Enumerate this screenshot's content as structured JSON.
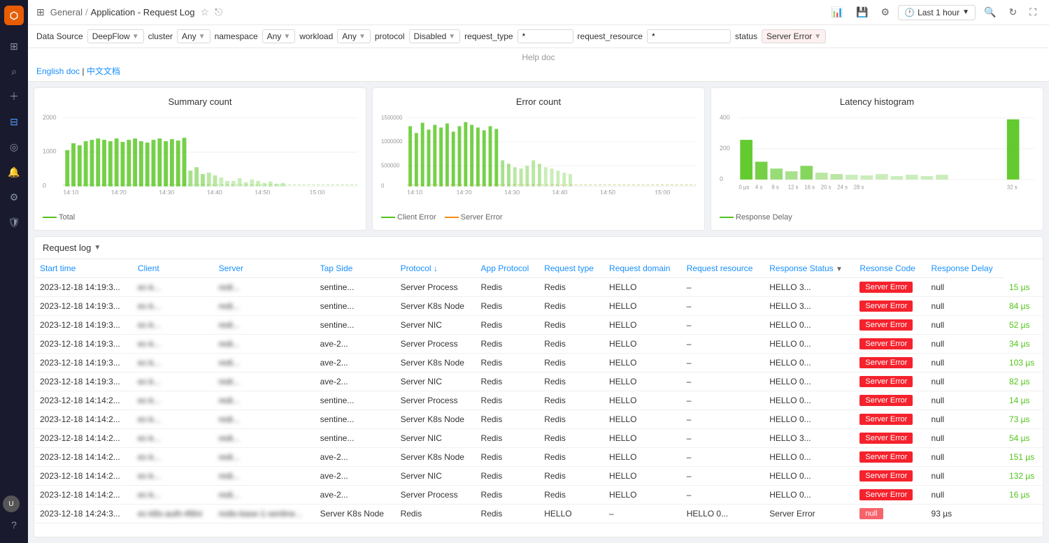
{
  "sidebar": {
    "logo": "D",
    "icons": [
      "⊞",
      "🔍",
      "+",
      "⊟",
      "◎",
      "🔔",
      "⚙",
      "🛡"
    ]
  },
  "topbar": {
    "breadcrumb": "General / Application - Request Log",
    "time_label": "Last 1 hour",
    "icons": [
      "chart",
      "save",
      "settings",
      "time",
      "zoom-in",
      "refresh",
      "fullscreen"
    ]
  },
  "filters": {
    "data_source_label": "Data Source",
    "data_source_value": "DeepFlow",
    "cluster_label": "cluster",
    "cluster_value": "Any",
    "namespace_label": "namespace",
    "namespace_value": "Any",
    "workload_label": "workload",
    "workload_value": "Any",
    "protocol_label": "protocol",
    "protocol_value": "Disabled",
    "request_type_label": "request_type",
    "request_type_value": "*",
    "request_resource_label": "request_resource",
    "request_resource_value": "*",
    "status_label": "status",
    "status_value": "Server Error"
  },
  "help_doc": {
    "title": "Help doc",
    "english_link": "English doc",
    "chinese_link": "中文文档",
    "separator": " | "
  },
  "charts": {
    "summary": {
      "title": "Summary count",
      "y_labels": [
        "2000",
        "1000",
        "0"
      ],
      "x_labels": [
        "14:10",
        "14:20",
        "14:30",
        "14:40",
        "14:50",
        "15:00"
      ],
      "legend": "Total"
    },
    "error": {
      "title": "Error count",
      "y_labels": [
        "1500000",
        "1000000",
        "500000",
        "0"
      ],
      "x_labels": [
        "14:10",
        "14:20",
        "14:30",
        "14:40",
        "14:50",
        "15:00"
      ],
      "legend_client": "Client Error",
      "legend_server": "Server Error"
    },
    "latency": {
      "title": "Latency histogram",
      "y_labels": [
        "400",
        "200",
        "0"
      ],
      "x_labels": [
        "0 µs",
        "4 s",
        "8 s",
        "12 s",
        "16 s",
        "20 s",
        "24 s",
        "28 s",
        "32 s"
      ],
      "legend": "Response Delay"
    }
  },
  "table": {
    "title": "Request log",
    "columns": [
      "Start time",
      "Client",
      "Server",
      "Tap Side",
      "Protocol",
      "App Protocol",
      "Request type",
      "Request domain",
      "Request resource",
      "Response Status",
      "Resonse Code",
      "Response Delay"
    ],
    "rows": [
      [
        "2023-12-18 14:19:3...",
        "ec-k...",
        "redi...",
        "sentine...",
        "Server Process",
        "Redis",
        "Redis",
        "HELLO",
        "–",
        "HELLO 3...",
        "Server Error",
        "null",
        "15 µs"
      ],
      [
        "2023-12-18 14:19:3...",
        "ec-k...",
        "redi...",
        "sentine...",
        "Server K8s Node",
        "Redis",
        "Redis",
        "HELLO",
        "–",
        "HELLO 3...",
        "Server Error",
        "null",
        "84 µs"
      ],
      [
        "2023-12-18 14:19:3...",
        "ec-k...",
        "redi...",
        "sentine...",
        "Server NIC",
        "Redis",
        "Redis",
        "HELLO",
        "–",
        "HELLO 0...",
        "Server Error",
        "null",
        "52 µs"
      ],
      [
        "2023-12-18 14:19:3...",
        "ec-k...",
        "redi...",
        "ave-2...",
        "Server Process",
        "Redis",
        "Redis",
        "HELLO",
        "–",
        "HELLO 0...",
        "Server Error",
        "null",
        "34 µs"
      ],
      [
        "2023-12-18 14:19:3...",
        "ec-k...",
        "redi...",
        "ave-2...",
        "Server K8s Node",
        "Redis",
        "Redis",
        "HELLO",
        "–",
        "HELLO 0...",
        "Server Error",
        "null",
        "103 µs"
      ],
      [
        "2023-12-18 14:19:3...",
        "ec-k...",
        "redi...",
        "ave-2...",
        "Server NIC",
        "Redis",
        "Redis",
        "HELLO",
        "–",
        "HELLO 0...",
        "Server Error",
        "null",
        "82 µs"
      ],
      [
        "2023-12-18 14:14:2...",
        "ec-k...",
        "redi...",
        "sentine...",
        "Server Process",
        "Redis",
        "Redis",
        "HELLO",
        "–",
        "HELLO 0...",
        "Server Error",
        "null",
        "14 µs"
      ],
      [
        "2023-12-18 14:14:2...",
        "ec-k...",
        "redi...",
        "sentine...",
        "Server K8s Node",
        "Redis",
        "Redis",
        "HELLO",
        "–",
        "HELLO 0...",
        "Server Error",
        "null",
        "73 µs"
      ],
      [
        "2023-12-18 14:14:2...",
        "ec-k...",
        "redi...",
        "sentine...",
        "Server NIC",
        "Redis",
        "Redis",
        "HELLO",
        "–",
        "HELLO 3...",
        "Server Error",
        "null",
        "54 µs"
      ],
      [
        "2023-12-18 14:14:2...",
        "ec-k...",
        "redi...",
        "ave-2...",
        "Server K8s Node",
        "Redis",
        "Redis",
        "HELLO",
        "–",
        "HELLO 0...",
        "Server Error",
        "null",
        "151 µs"
      ],
      [
        "2023-12-18 14:14:2...",
        "ec-k...",
        "redi...",
        "ave-2...",
        "Server NIC",
        "Redis",
        "Redis",
        "HELLO",
        "–",
        "HELLO 0...",
        "Server Error",
        "null",
        "132 µs"
      ],
      [
        "2023-12-18 14:14:2...",
        "ec-k...",
        "redi...",
        "ave-2...",
        "Server Process",
        "Redis",
        "Redis",
        "HELLO",
        "–",
        "HELLO 0...",
        "Server Error",
        "null",
        "16 µs"
      ],
      [
        "2023-12-18 14:24:3...",
        "ec-k8s-auth-46lni",
        "redis-base-1-sentine...",
        "Server K8s Node",
        "Redis",
        "Redis",
        "HELLO",
        "–",
        "HELLO 0...",
        "Server Error",
        "null",
        "93 µs"
      ]
    ]
  }
}
